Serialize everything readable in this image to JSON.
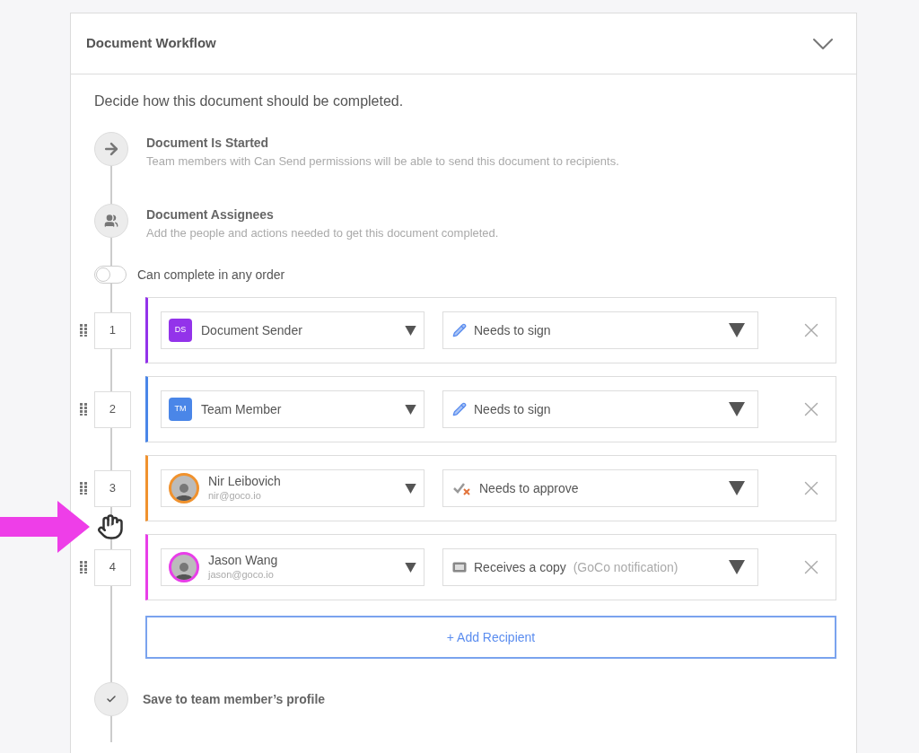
{
  "panel": {
    "title": "Document Workflow",
    "expanded": true
  },
  "intro": "Decide how this document should be completed.",
  "steps": [
    {
      "kind": "start",
      "title": "Document Is Started",
      "description": "Team members with Can Send permissions will be able to send this document to recipients."
    },
    {
      "kind": "assignees",
      "title": "Document Assignees",
      "description": "Add the people and actions needed to get this document completed."
    }
  ],
  "order_toggle": {
    "label": "Can complete in any order",
    "on": false
  },
  "recipients": [
    {
      "number": "1",
      "kind": "initials",
      "initials": "DS",
      "name": "Document Sender",
      "color": "#9333ea",
      "action": {
        "kind": "sign",
        "label": "Needs to sign"
      }
    },
    {
      "number": "2",
      "kind": "initials",
      "initials": "TM",
      "name": "Team Member",
      "color": "#4a86e8",
      "action": {
        "kind": "sign",
        "label": "Needs to sign"
      }
    },
    {
      "number": "3",
      "kind": "person",
      "name": "Nir Leibovich",
      "email": "nir@goco.io",
      "color": "#f0922e",
      "action": {
        "kind": "approve",
        "label": "Needs to approve"
      }
    },
    {
      "number": "4",
      "kind": "person",
      "name": "Jason Wang",
      "email": "jason@goco.io",
      "color": "#e83ee8",
      "action": {
        "kind": "copy",
        "label": "Receives a copy",
        "note": "(GoCo notification)"
      }
    }
  ],
  "add_button": "+ Add Recipient",
  "final_step": {
    "title": "Save to team member’s profile"
  }
}
